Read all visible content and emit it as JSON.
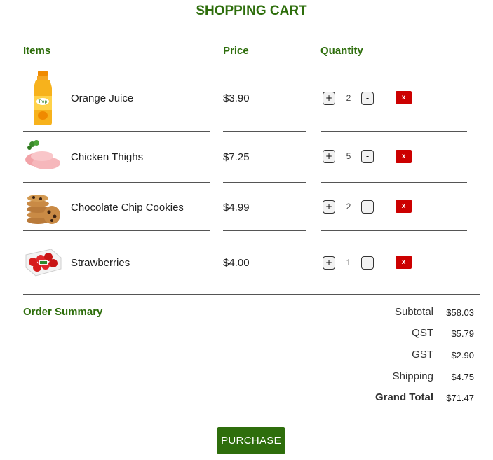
{
  "title": "SHOPPING CART",
  "headers": {
    "items": "Items",
    "price": "Price",
    "quantity": "Quantity"
  },
  "items": [
    {
      "name": "Orange Juice",
      "price": "$3.90",
      "quantity": "2",
      "image": "orange-juice-image"
    },
    {
      "name": "Chicken Thighs",
      "price": "$7.25",
      "quantity": "5",
      "image": "chicken-thighs-image"
    },
    {
      "name": "Chocolate Chip Cookies",
      "price": "$4.99",
      "quantity": "2",
      "image": "cookies-image"
    },
    {
      "name": "Strawberries",
      "price": "$4.00",
      "quantity": "1",
      "image": "strawberries-image"
    }
  ],
  "controls": {
    "plus": "+",
    "minus": "-",
    "remove": "x"
  },
  "summary": {
    "title": "Order Summary",
    "subtotal_label": "Subtotal",
    "subtotal": "$58.03",
    "qst_label": "QST",
    "qst": "$5.79",
    "gst_label": "GST",
    "gst": "$2.90",
    "shipping_label": "Shipping",
    "shipping": "$4.75",
    "grand_total_label": "Grand Total",
    "grand_total": "$71.47"
  },
  "purchase_label": "PURCHASE",
  "colors": {
    "accent": "#2e6e0c",
    "remove": "#cc0000"
  }
}
